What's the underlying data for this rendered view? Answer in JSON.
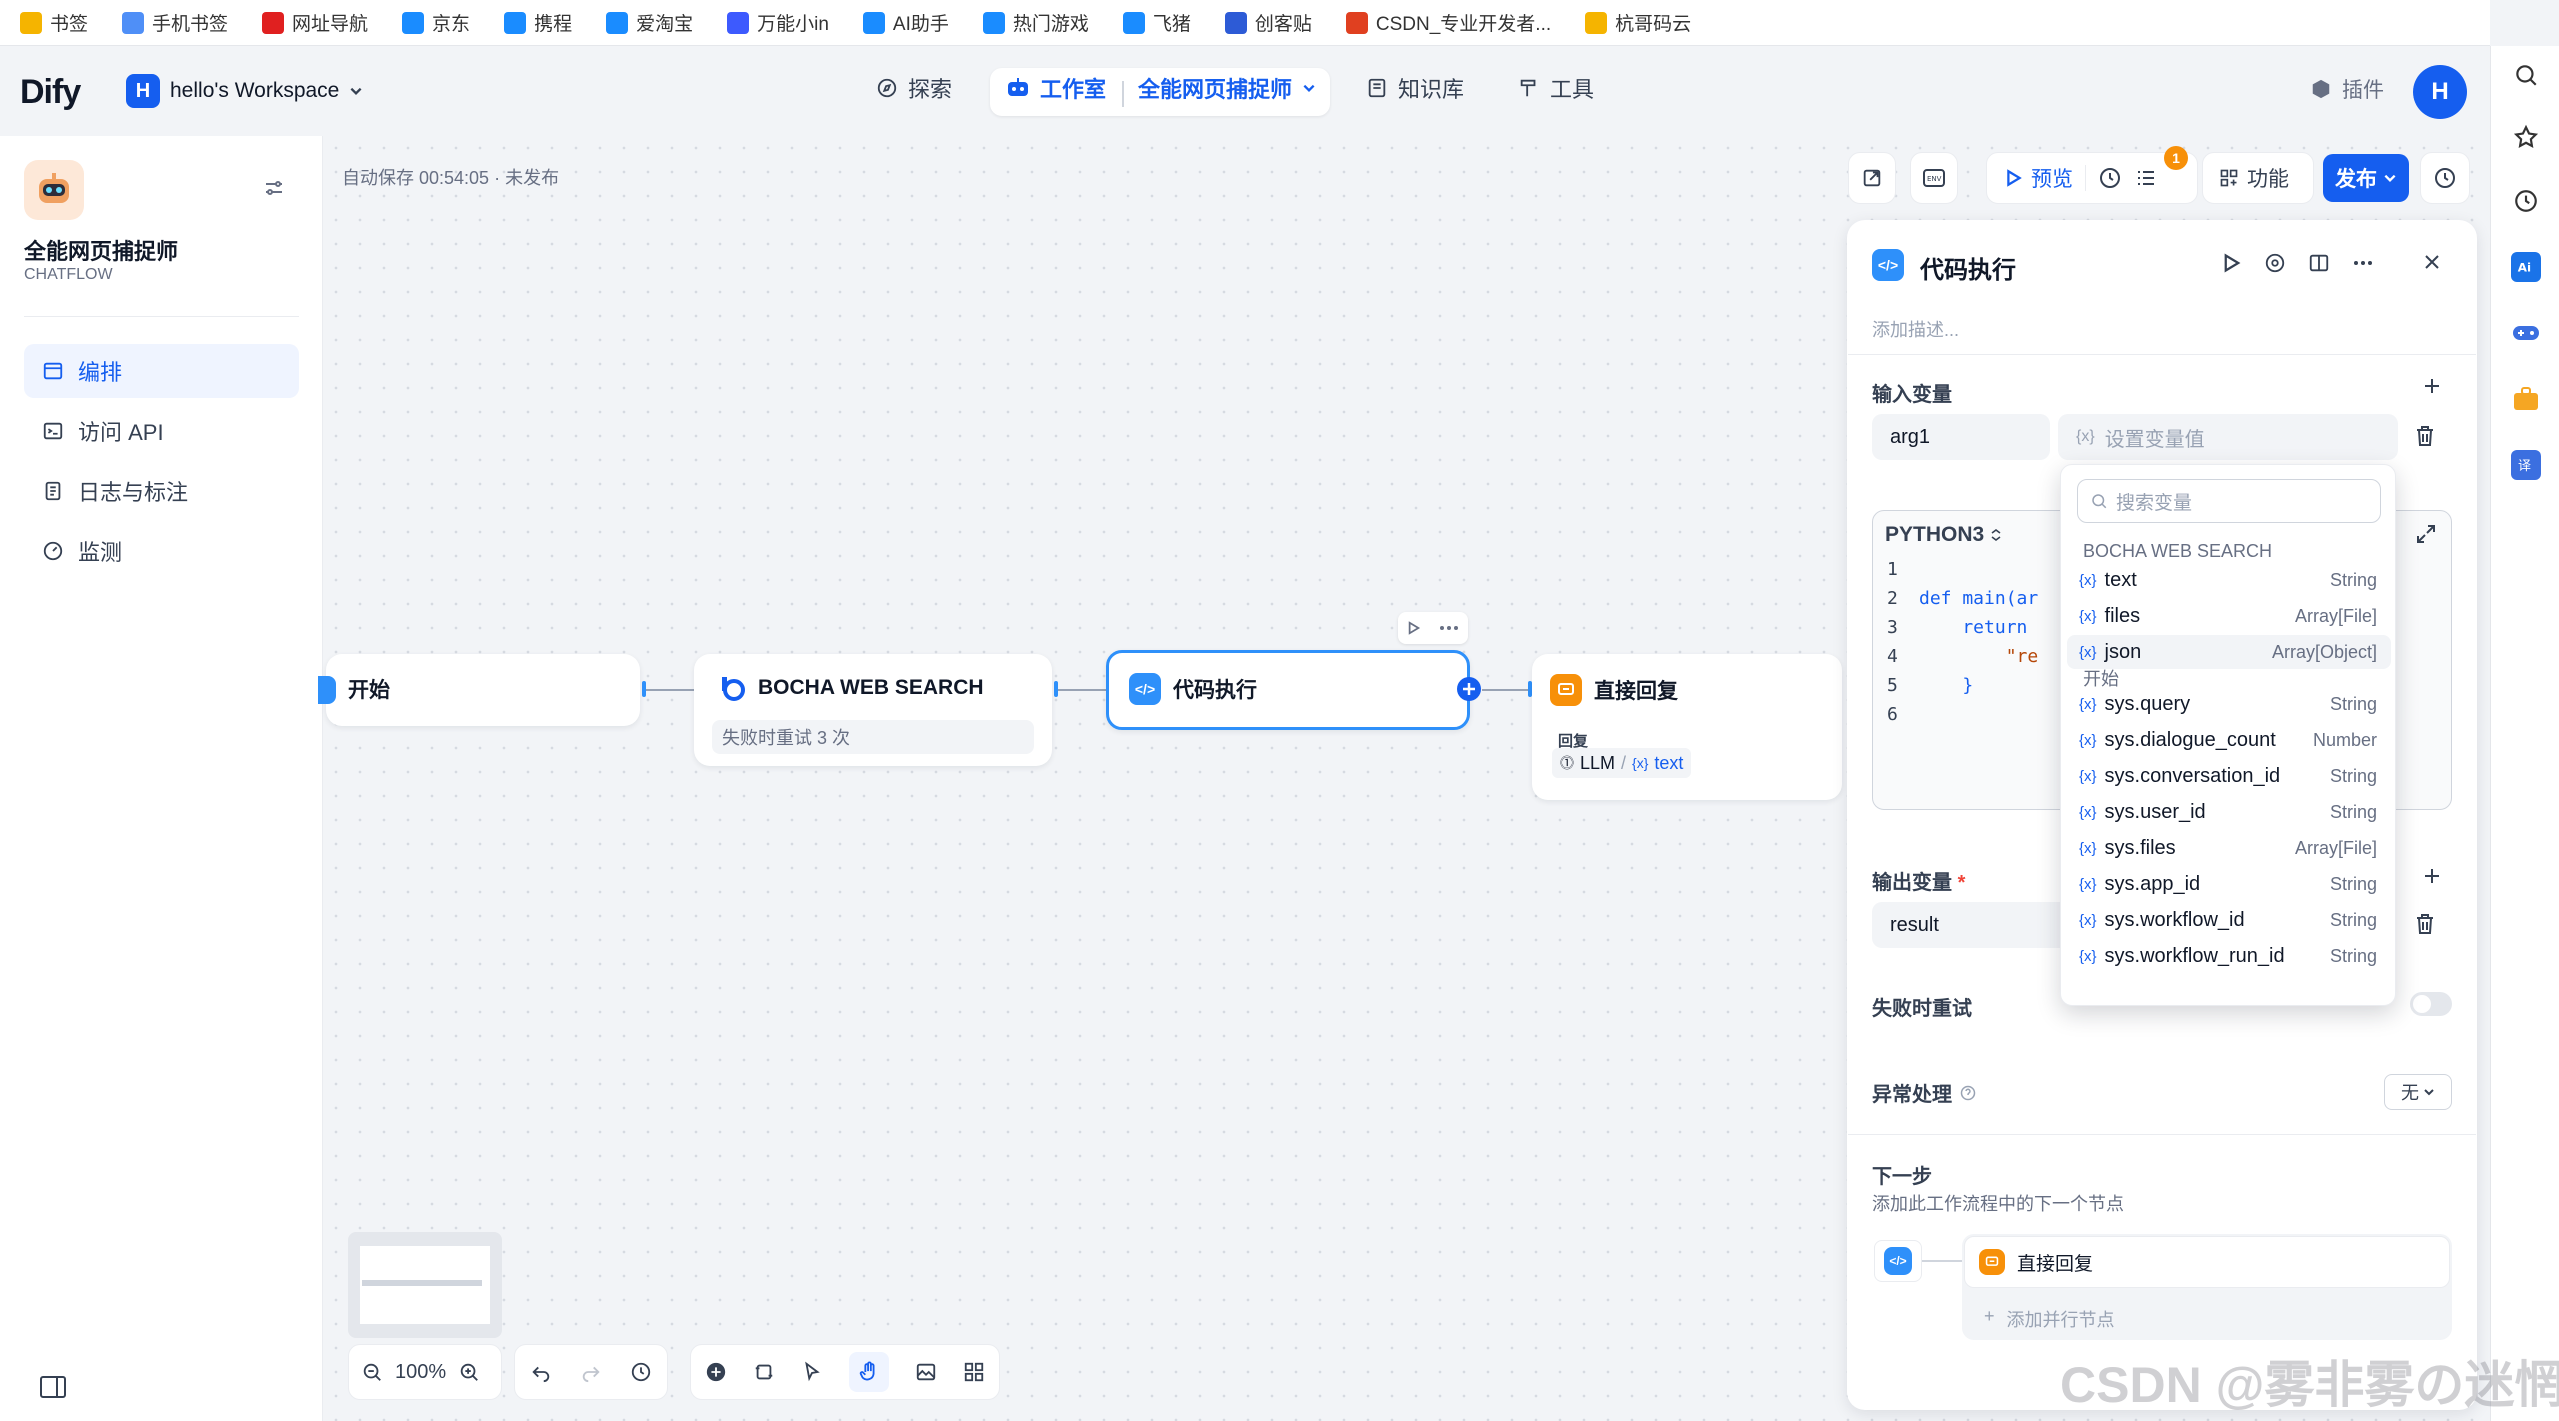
{
  "bookmarks": [
    {
      "label": "书签",
      "color": "#f5b400"
    },
    {
      "label": "手机书签",
      "color": "#4f8ff7"
    },
    {
      "label": "网址导航",
      "color": "#e02020"
    },
    {
      "label": "京东",
      "color": "#1a8cff"
    },
    {
      "label": "携程",
      "color": "#1a8cff"
    },
    {
      "label": "爱淘宝",
      "color": "#1a8cff"
    },
    {
      "label": "万能小in",
      "color": "#3d5afe"
    },
    {
      "label": "AI助手",
      "color": "#1a8cff"
    },
    {
      "label": "热门游戏",
      "color": "#1a8cff"
    },
    {
      "label": "飞猪",
      "color": "#1a8cff"
    },
    {
      "label": "创客贴",
      "color": "#2d5bd6"
    },
    {
      "label": "CSDN_专业开发者...",
      "color": "#e04020"
    },
    {
      "label": "杭哥码云",
      "color": "#f5b400"
    }
  ],
  "header": {
    "logo": "Dify",
    "workspace_badge": "H",
    "workspace": "hello's Workspace",
    "nav_explore": "探索",
    "nav_studio": "工作室",
    "nav_app": "全能网页捕捉师",
    "nav_knowledge": "知识库",
    "nav_tools": "工具",
    "plugins": "插件",
    "avatar": "H"
  },
  "sidebar": {
    "app_name": "全能网页捕捉师",
    "app_type": "CHATFLOW",
    "items": [
      {
        "label": "编排",
        "active": true
      },
      {
        "label": "访问 API",
        "active": false
      },
      {
        "label": "日志与标注",
        "active": false
      },
      {
        "label": "监测",
        "active": false
      }
    ]
  },
  "canvas": {
    "autosave": "自动保存 00:54:05 · 未发布",
    "toolbar": {
      "preview": "预览",
      "badge": "1",
      "features": "功能",
      "publish": "发布"
    },
    "nodes": {
      "start": "开始",
      "bocha": "BOCHA WEB SEARCH",
      "bocha_retry": "失败时重试 3 次",
      "code": "代码执行",
      "reply": "直接回复",
      "reply_label": "回复",
      "reply_llm": "LLM",
      "reply_sep": "/",
      "reply_var": "text"
    },
    "zoom": "100%"
  },
  "panel": {
    "title": "代码执行",
    "desc_placeholder": "添加描述...",
    "input_vars_label": "输入变量",
    "input_var_name": "arg1",
    "input_var_placeholder": "设置变量值",
    "lang": "PYTHON3",
    "code_lines": [
      "1",
      "2",
      "3",
      "4",
      "5",
      "6"
    ],
    "code": [
      "",
      "def main(ar",
      "    return",
      "        \"re",
      "    }",
      ""
    ],
    "output_vars_label": "输出变量",
    "required_mark": "*",
    "output_var_name": "result",
    "retry_label": "失败时重试",
    "exception_label": "异常处理",
    "exception_value": "无",
    "next_label": "下一步",
    "next_desc": "添加此工作流程中的下一个节点",
    "next_node": "直接回复",
    "add_parallel": "添加并行节点"
  },
  "dropdown": {
    "search_placeholder": "搜索变量",
    "group1": "BOCHA WEB SEARCH",
    "group1_items": [
      {
        "name": "text",
        "type": "String"
      },
      {
        "name": "files",
        "type": "Array[File]"
      },
      {
        "name": "json",
        "type": "Array[Object]"
      }
    ],
    "group2": "开始",
    "group2_items": [
      {
        "name": "sys.query",
        "type": "String"
      },
      {
        "name": "sys.dialogue_count",
        "type": "Number"
      },
      {
        "name": "sys.conversation_id",
        "type": "String"
      },
      {
        "name": "sys.user_id",
        "type": "String"
      },
      {
        "name": "sys.files",
        "type": "Array[File]"
      },
      {
        "name": "sys.app_id",
        "type": "String"
      },
      {
        "name": "sys.workflow_id",
        "type": "String"
      },
      {
        "name": "sys.workflow_run_id",
        "type": "String"
      }
    ]
  },
  "watermark": "CSDN @雾非雾の迷惘",
  "colors": {
    "accent": "#155eef",
    "code_node": "#2e90fa",
    "reply_node": "#f79009"
  }
}
